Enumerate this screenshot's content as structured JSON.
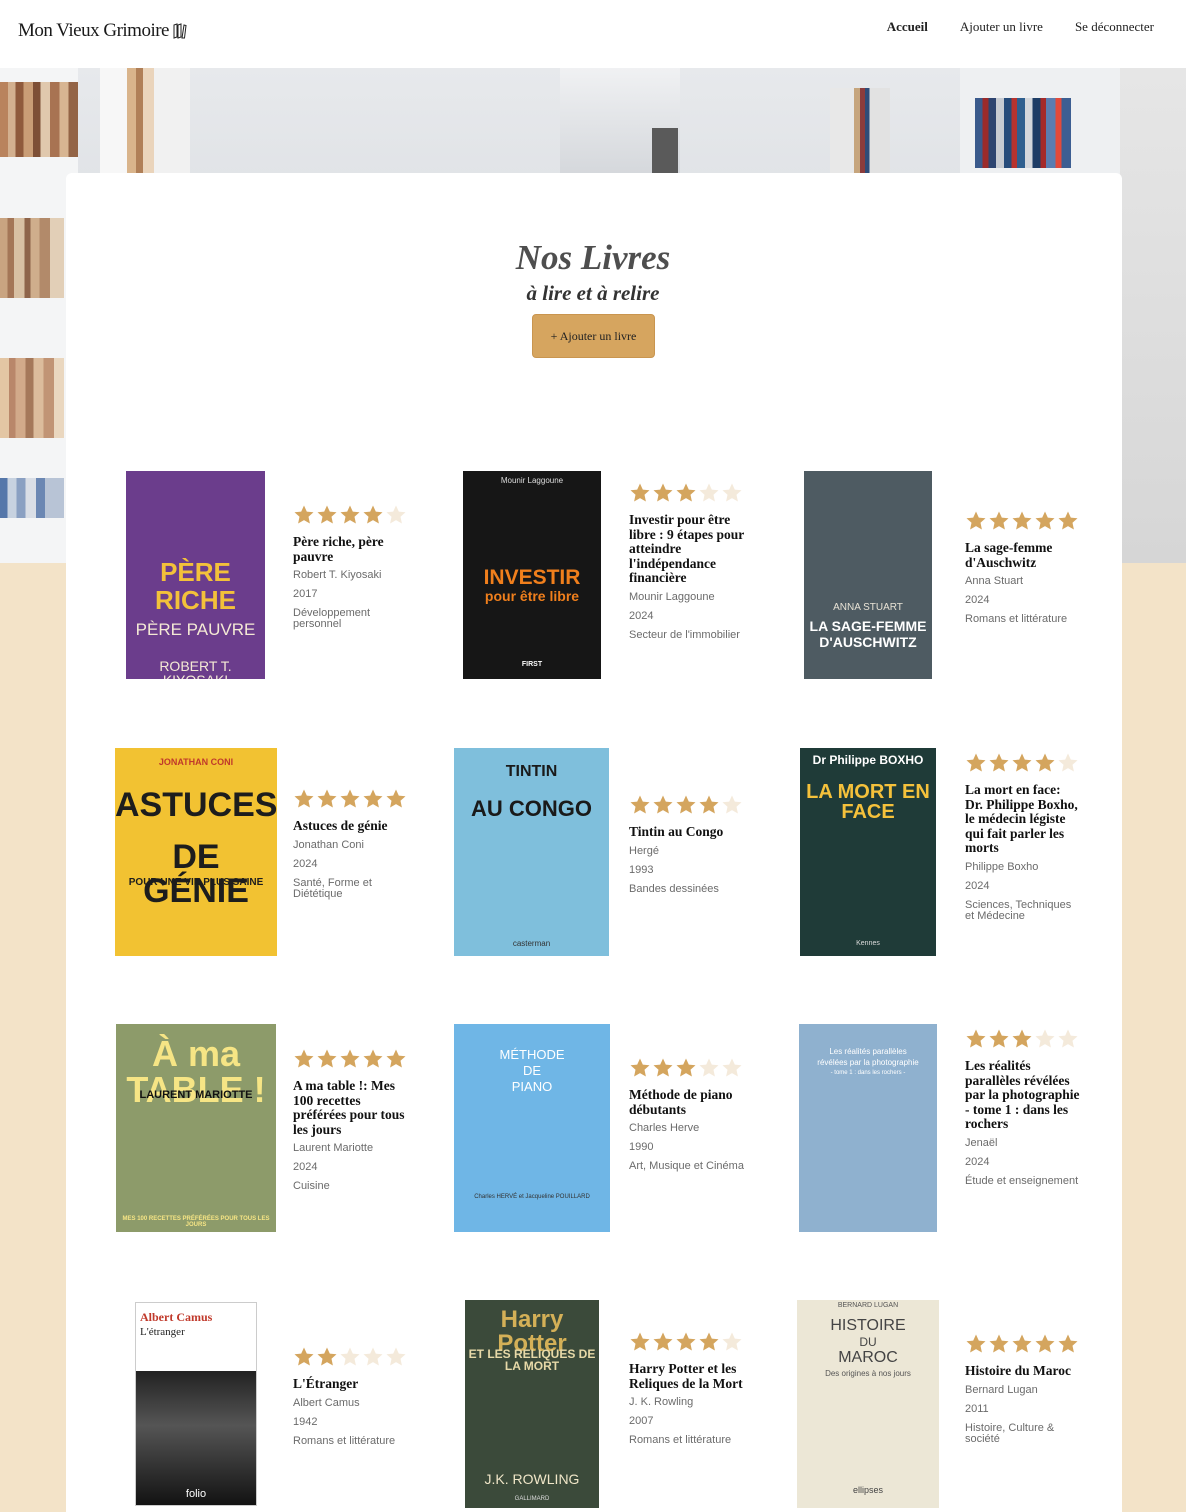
{
  "header": {
    "logo": "Mon Vieux Grimoire",
    "nav": [
      "Accueil",
      "Ajouter un livre",
      "Se déconnecter"
    ]
  },
  "page": {
    "title": "Nos Livres",
    "subtitle": "à lire et à relire",
    "add_button": "+ Ajouter un livre"
  },
  "colors": {
    "accent": "#d6a55f",
    "background": "#f3e3c8",
    "star_on": "#d4a55e",
    "star_off": "#f4eadb"
  },
  "books": [
    {
      "title": "Père riche, père pauvre",
      "author": "Robert T. Kiyosaki",
      "year": "2017",
      "genre": "Développement personnel",
      "rating": 4,
      "cover": {
        "bg": "#6b3d8c",
        "lines": [
          "PÈRE",
          "RICHE",
          "PÈRE PAUVRE",
          "ROBERT T. KIYOSAKI"
        ]
      }
    },
    {
      "title": "Investir pour être libre : 9 étapes pour atteindre l'indépendance financière",
      "author": "Mounir Laggoune",
      "year": "2024",
      "genre": "Secteur de l'immobilier",
      "rating": 3,
      "cover": {
        "bg": "#161616",
        "lines": [
          "Mounir Laggoune",
          "INVESTIR",
          "pour être libre",
          "FIRST"
        ]
      }
    },
    {
      "title": "La sage-femme d'Auschwitz",
      "author": "Anna Stuart",
      "year": "2024",
      "genre": "Romans et littérature",
      "rating": 5,
      "cover": {
        "bg": "#4e5b62",
        "lines": [
          "ANNA STUART",
          "LA SAGE-FEMME",
          "D'AUSCHWITZ"
        ]
      }
    },
    {
      "title": "Astuces de génie",
      "author": "Jonathan Coni",
      "year": "2024",
      "genre": "Santé, Forme et Diététique",
      "rating": 5,
      "cover": {
        "bg": "#f2c232",
        "lines": [
          "JONATHAN CONI",
          "ASTUCES",
          "DE GÉNIE",
          "POUR UNE VIE PLUS SAINE"
        ]
      }
    },
    {
      "title": "Tintin au Congo",
      "author": "Hergé",
      "year": "1993",
      "genre": "Bandes dessinées",
      "rating": 4,
      "cover": {
        "bg": "#7fbfdc",
        "lines": [
          "TINTIN",
          "AU CONGO",
          "casterman"
        ]
      }
    },
    {
      "title": "La mort en face: Dr. Philippe Boxho, le médecin légiste qui fait parler les morts",
      "author": "Philippe Boxho",
      "year": "2024",
      "genre": "Sciences, Techniques et Médecine",
      "rating": 4,
      "cover": {
        "bg": "#1f3b38",
        "lines": [
          "Dr Philippe BOXHO",
          "LA MORT EN FACE",
          "Kennes"
        ]
      }
    },
    {
      "title": "A ma table !: Mes 100 recettes préférées pour tous les jours",
      "author": "Laurent Mariotte",
      "year": "2024",
      "genre": "Cuisine",
      "rating": 5,
      "cover": {
        "bg": "#8d9b6a",
        "lines": [
          "À ma TABLE !",
          "LAURENT MARIOTTE",
          "MES 100 RECETTES PRÉFÉRÉES POUR TOUS LES JOURS"
        ]
      }
    },
    {
      "title": "Méthode de piano débutants",
      "author": "Charles Herve",
      "year": "1990",
      "genre": "Art, Musique et Cinéma",
      "rating": 3,
      "cover": {
        "bg": "#6fb6e6",
        "lines": [
          "MÉTHODE",
          "DE",
          "PIANO",
          "Charles HERVÉ et Jacqueline POUILLARD"
        ]
      }
    },
    {
      "title": "Les réalités parallèles révélées par la photographie - tome 1 : dans les rochers",
      "author": "Jenaël",
      "year": "2024",
      "genre": "Étude et enseignement",
      "rating": 3,
      "cover": {
        "bg": "#8fb1cf",
        "lines": [
          "Les réalités parallèles",
          "révélées par la photographie",
          "- tome 1 : dans les rochers -"
        ]
      }
    },
    {
      "title": "L'Étranger",
      "author": "Albert Camus",
      "year": "1942",
      "genre": "Romans et littérature",
      "rating": 2,
      "cover": {
        "bg": "#ffffff",
        "lines": [
          "Albert Camus",
          "L'étranger",
          "folio"
        ]
      }
    },
    {
      "title": "Harry Potter et les Reliques de la Mort",
      "author": "J. K. Rowling",
      "year": "2007",
      "genre": "Romans et littérature",
      "rating": 4,
      "cover": {
        "bg": "#3b4a3a",
        "lines": [
          "Harry Potter",
          "ET LES RELIQUES DE LA MORT",
          "J.K. ROWLING",
          "GALLIMARD"
        ]
      }
    },
    {
      "title": "Histoire du Maroc",
      "author": "Bernard Lugan",
      "year": "2011",
      "genre": "Histoire, Culture & société",
      "rating": 5,
      "cover": {
        "bg": "#ece7d6",
        "lines": [
          "BERNARD LUGAN",
          "HISTOIRE",
          "DU",
          "MAROC",
          "Des origines à nos jours",
          "ellipses"
        ]
      }
    }
  ]
}
